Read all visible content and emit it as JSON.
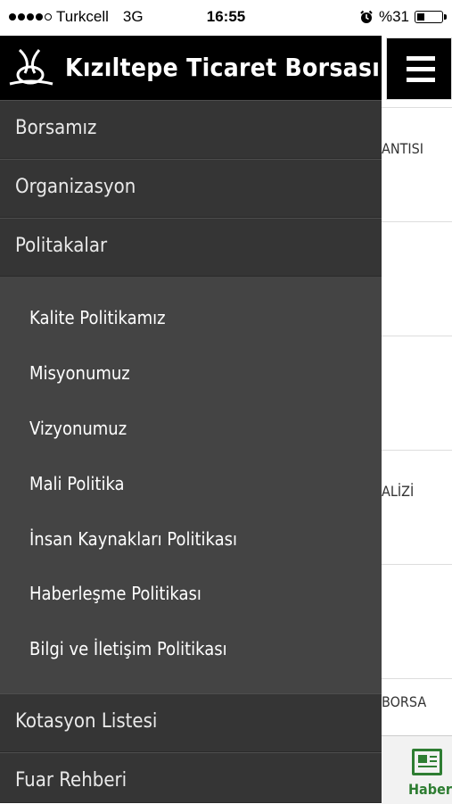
{
  "status_bar": {
    "carrier": "Turkcell",
    "network": "3G",
    "time": "16:55",
    "battery": "%31",
    "battery_level": 0.31
  },
  "drawer": {
    "title": "Kızıltepe Ticaret Borsası",
    "items": [
      {
        "label": "Borsamız"
      },
      {
        "label": "Organizasyon"
      },
      {
        "label": "Politakalar"
      },
      {
        "label": "Kotasyon Listesi"
      },
      {
        "label": "Fuar Rehberi"
      }
    ],
    "submenu": [
      {
        "label": "Kalite Politikamız"
      },
      {
        "label": "Misyonumuz"
      },
      {
        "label": "Vizyonumuz"
      },
      {
        "label": "Mali Politika"
      },
      {
        "label": "İnsan Kaynakları Politikası"
      },
      {
        "label": "Haberleşme Politikası"
      },
      {
        "label": "Bilgi ve İletişim Politikası"
      }
    ]
  },
  "background": {
    "rows": [
      "ANTISI",
      "",
      "",
      "ALİZİ",
      "",
      "BORSA"
    ],
    "tab_label": "Haber",
    "accent_color": "#2e7d32"
  }
}
